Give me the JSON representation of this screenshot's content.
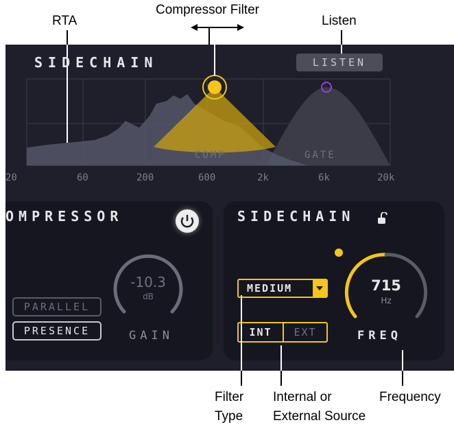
{
  "callouts": {
    "rta": "RTA",
    "compressor_filter": "Compressor Filter",
    "listen": "Listen",
    "filter_type": [
      "Filter",
      "Type"
    ],
    "source": [
      "Internal or",
      "External Source"
    ],
    "frequency": "Frequency"
  },
  "graph": {
    "title": "SIDECHAIN",
    "listen_button": "LISTEN",
    "comp_label": "COMP",
    "gate_label": "GATE",
    "freq_ticks": [
      "20",
      "60",
      "200",
      "600",
      "2k",
      "6k",
      "20k"
    ]
  },
  "compressor": {
    "title": "OMPRESSOR",
    "gain_value": "-10.3",
    "gain_unit": "dB",
    "gain_label": "GAIN",
    "parallel_button": "PARALLEL",
    "presence_button": "PRESENCE"
  },
  "sidechain": {
    "title": "SIDECHAIN",
    "filter_type": "MEDIUM",
    "source_int": "INT",
    "source_ext": "EXT",
    "freq_value": "715",
    "freq_unit": "Hz",
    "freq_label": "FREQ"
  },
  "colors": {
    "accent": "#f5c518",
    "gate": "#9b3fd6",
    "panel": "#1e1f2b"
  }
}
